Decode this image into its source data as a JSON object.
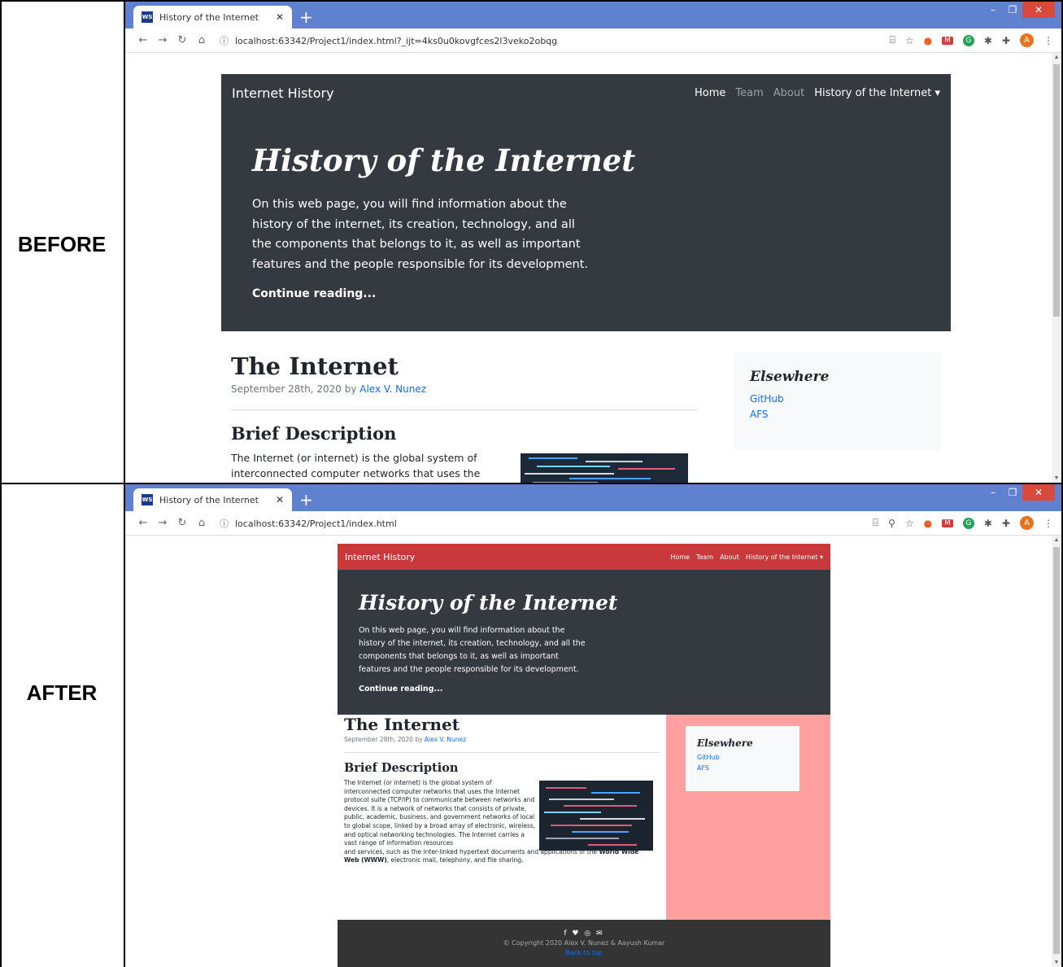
{
  "labels": {
    "before": "BEFORE",
    "after": "AFTER"
  },
  "before": {
    "tab": {
      "title": "History of the Internet",
      "favicon": "WS"
    },
    "url": "localhost:63342/Project1/index.html?_ijt=4ks0u0kovgfces2l3veko2obqg",
    "nav": {
      "brand": "Internet History",
      "links": [
        "Home",
        "Team",
        "About",
        "History of the Internet ▾"
      ]
    },
    "hero": {
      "title": "History of the Internet",
      "text": "On this web page, you will find information about the history of the internet, its creation, technology, and all the components that belongs to it, as well as important features and the people responsible for its development.",
      "cta": "Continue reading..."
    },
    "article": {
      "title": "The Internet",
      "meta_prefix": "September 28th, 2020 by ",
      "author": "Alex V. Nunez",
      "subtitle": "Brief Description",
      "text": "The Internet (or internet) is the global system of interconnected computer networks that uses the Internet"
    },
    "aside": {
      "title": "Elsewhere",
      "links": [
        "GitHub",
        "AFS"
      ]
    }
  },
  "after": {
    "tab": {
      "title": "History of the Internet",
      "favicon": "WS"
    },
    "url": "localhost:63342/Project1/index.html",
    "nav": {
      "brand": "Internet History",
      "links": [
        "Home",
        "Team",
        "About",
        "History of the Internet ▾"
      ]
    },
    "hero": {
      "title": "History of the Internet",
      "text": "On this web page, you will find information about the history of the internet, its creation, technology, and all the components that belongs to it, as well as important features and the people responsible for its development.",
      "cta": "Continue reading..."
    },
    "article": {
      "title": "The Internet",
      "meta_prefix": "September 28th, 2020 by ",
      "author": "Alex V. Nunez",
      "subtitle": "Brief Description",
      "text1": "The Internet (or internet) is the global system of interconnected computer networks that uses the Internet protocol suite (TCP/IP) to communicate between networks and devices. It is a network of networks that consists of private, public, academic, business, and government networks of local to global scope, linked by a broad array of electronic, wireless, and optical networking technologies. The Internet carries a vast range of information resources",
      "text2_a": "and services, such as the inter-linked hypertext documents and applications of the ",
      "text2_bold": "World Wide Web (WWW)",
      "text2_b": ", electronic mail, telephony, and file sharing."
    },
    "aside": {
      "title": "Elsewhere",
      "links": [
        "GitHub",
        "AFS"
      ]
    },
    "footer": {
      "icons": "f ♥ ◎ ✉",
      "copyright": "© Copyright 2020 Alex V. Nunez & Aayush Kumar",
      "back_to_top": "Back to top"
    }
  },
  "colors": {
    "chrome": "#5f81cf",
    "dark": "#343a40",
    "navbar_after": "#c9393b",
    "sidebar_bg_after": "#ff9f9f",
    "link": "#0d6efd"
  }
}
